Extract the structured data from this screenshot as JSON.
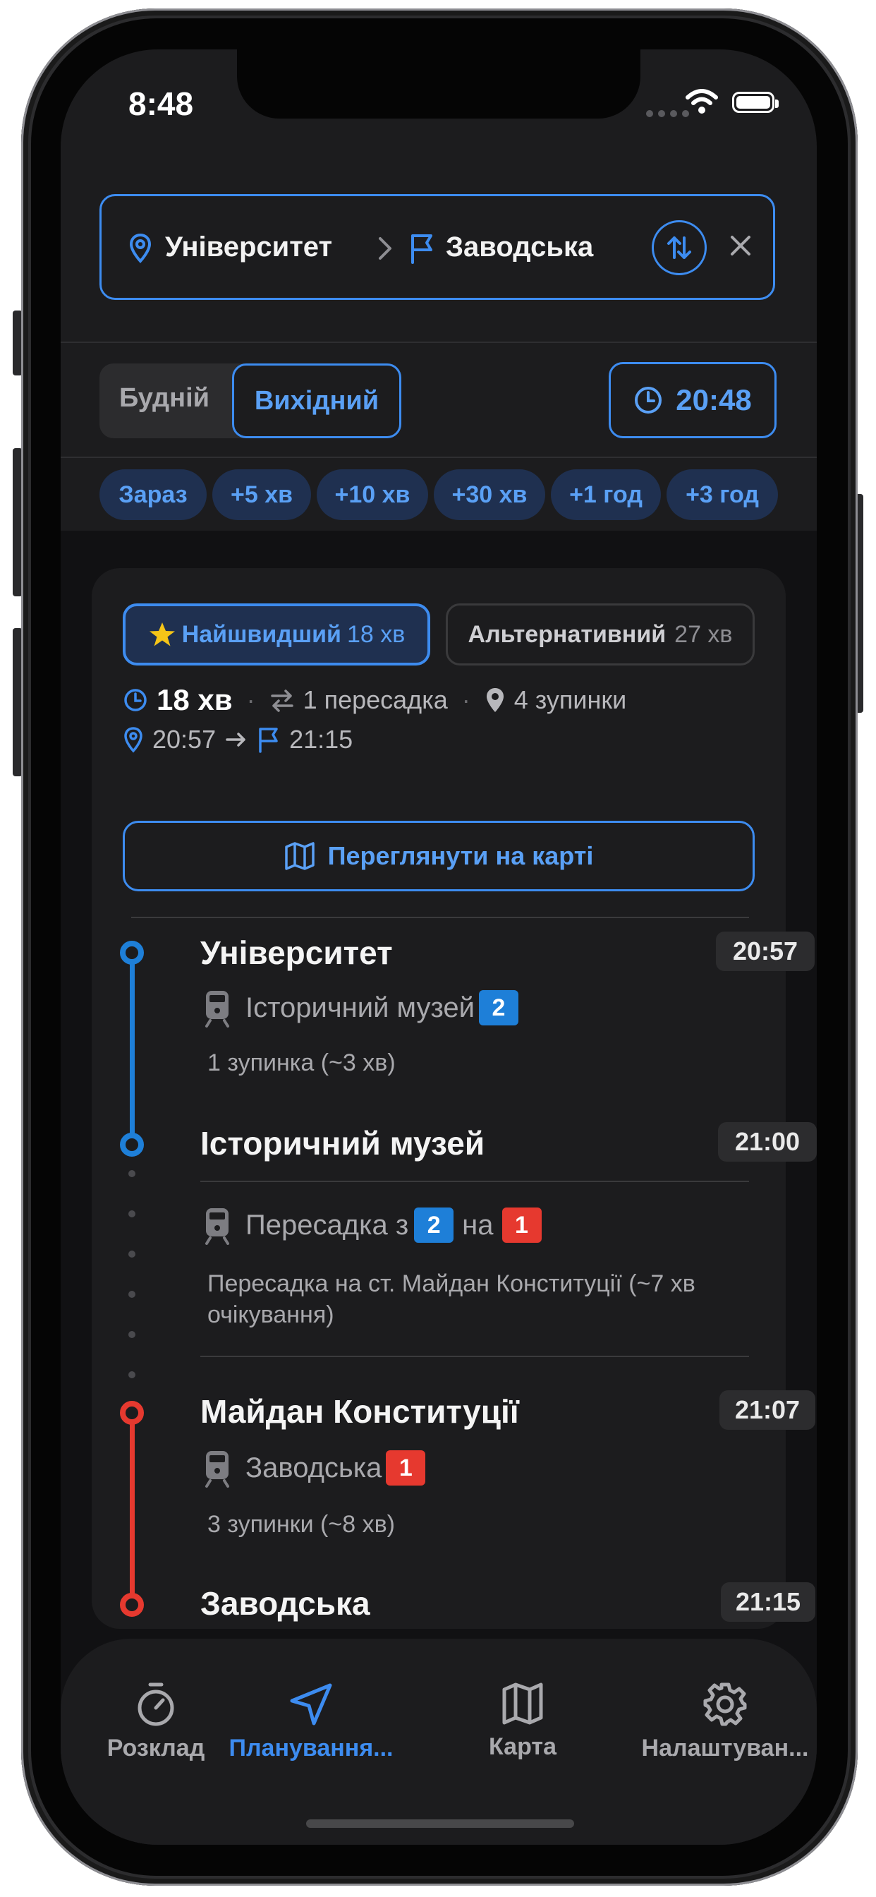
{
  "status_bar": {
    "time": "8:48"
  },
  "route": {
    "from": "Університет",
    "to": "Заводська"
  },
  "day_type": {
    "weekday": "Будній",
    "weekend": "Вихідний",
    "selected": "Вихідний"
  },
  "departure_time": "20:48",
  "quick_times": [
    "Зараз",
    "+5 хв",
    "+10 хв",
    "+30 хв",
    "+1 год",
    "+3 год"
  ],
  "options": {
    "fastest": {
      "label": "Найшвидший",
      "duration": "18 хв"
    },
    "alternative": {
      "label": "Альтернативний",
      "duration": "27 хв"
    }
  },
  "summary": {
    "duration": "18 хв",
    "transfers": "1 пересадка",
    "stops": "4 зупинки",
    "depart": "20:57",
    "arrive": "21:15"
  },
  "map_button": "Переглянути на карті",
  "journey": [
    {
      "station": "Університет",
      "time": "20:57"
    },
    {
      "direction": "Історичний музей",
      "line": "2",
      "line_color": "#1e7fd8",
      "note": "1 зупинка (~3 хв)"
    },
    {
      "station": "Історичний музей",
      "time": "21:00"
    },
    {
      "transfer_prefix": "Пересадка з",
      "from_line": "2",
      "mid": "на",
      "to_line": "1",
      "note": "Пересадка на ст. Майдан Конституції (~7 хв очікування)"
    },
    {
      "station": "Майдан Конституції",
      "time": "21:07"
    },
    {
      "direction": "Заводська",
      "line": "1",
      "line_color": "#e6392f",
      "note": "3 зупинки (~8 хв)"
    },
    {
      "station": "Заводська",
      "time": "21:15"
    }
  ],
  "tabs": [
    {
      "label": "Розклад",
      "icon": "stopwatch-icon",
      "active": false
    },
    {
      "label": "Планування...",
      "icon": "navigation-arrow-icon",
      "active": true
    },
    {
      "label": "Карта",
      "icon": "map-icon",
      "active": false
    },
    {
      "label": "Налаштуван...",
      "icon": "gear-icon",
      "active": false
    }
  ],
  "colors": {
    "accent": "#3d8cf0",
    "line_blue": "#1e7fd8",
    "line_red": "#e6392f",
    "star": "#f5c518"
  }
}
